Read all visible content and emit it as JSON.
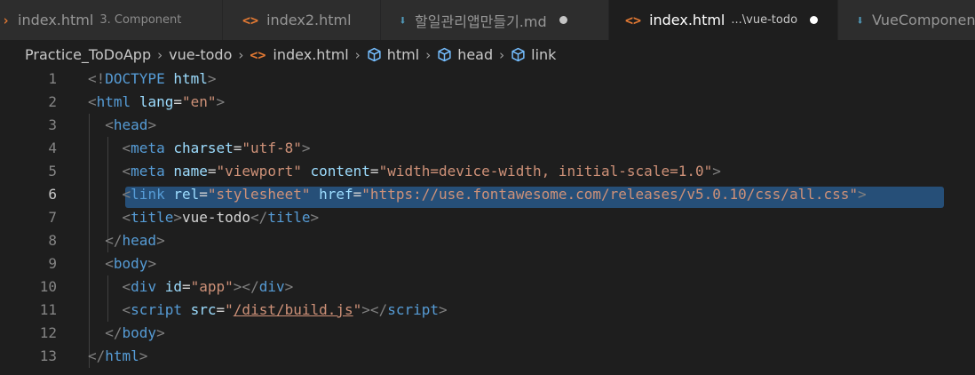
{
  "tabs": [
    {
      "icon": "html-file-icon",
      "label": "index.html",
      "description": "3. Component",
      "active": false,
      "modified": false
    },
    {
      "icon": "html-file-icon",
      "label": "index2.html",
      "description": "",
      "active": false,
      "modified": false
    },
    {
      "icon": "markdown-file-icon",
      "label": "할일관리앱만들기.md",
      "description": "",
      "active": false,
      "modified": true
    },
    {
      "icon": "html-file-icon",
      "label": "index.html",
      "description": "...\\vue-todo",
      "active": true,
      "modified": true
    },
    {
      "icon": "markdown-file-icon",
      "label": "VueComponents.md",
      "description": "",
      "active": false,
      "modified": false
    }
  ],
  "breadcrumb": {
    "folder1": "Practice_ToDoApp",
    "folder2": "vue-todo",
    "file": "index.html",
    "sym1": "html",
    "sym2": "head",
    "sym3": "link"
  },
  "editor": {
    "current_line": 6,
    "lines": [
      {
        "n": "1",
        "tokens": [
          [
            "p",
            "<!"
          ],
          [
            "t",
            "DOCTYPE"
          ],
          [
            "x",
            " "
          ],
          [
            "a",
            "html"
          ],
          [
            "p",
            ">"
          ]
        ]
      },
      {
        "n": "2",
        "tokens": [
          [
            "p",
            "<"
          ],
          [
            "t",
            "html"
          ],
          [
            "x",
            " "
          ],
          [
            "a",
            "lang"
          ],
          [
            "x",
            "="
          ],
          [
            "s",
            "\"en\""
          ],
          [
            "p",
            ">"
          ]
        ]
      },
      {
        "n": "3",
        "tokens": [
          [
            "x",
            "  "
          ],
          [
            "p",
            "<"
          ],
          [
            "t",
            "head"
          ],
          [
            "p",
            ">"
          ]
        ]
      },
      {
        "n": "4",
        "tokens": [
          [
            "x",
            "    "
          ],
          [
            "p",
            "<"
          ],
          [
            "t",
            "meta"
          ],
          [
            "x",
            " "
          ],
          [
            "a",
            "charset"
          ],
          [
            "x",
            "="
          ],
          [
            "s",
            "\"utf-8\""
          ],
          [
            "p",
            ">"
          ]
        ]
      },
      {
        "n": "5",
        "tokens": [
          [
            "x",
            "    "
          ],
          [
            "p",
            "<"
          ],
          [
            "t",
            "meta"
          ],
          [
            "x",
            " "
          ],
          [
            "a",
            "name"
          ],
          [
            "x",
            "="
          ],
          [
            "s",
            "\"viewport\""
          ],
          [
            "x",
            " "
          ],
          [
            "a",
            "content"
          ],
          [
            "x",
            "="
          ],
          [
            "s",
            "\"width=device-width, initial-scale=1.0\""
          ],
          [
            "p",
            ">"
          ]
        ]
      },
      {
        "n": "6",
        "tokens": [
          [
            "x",
            "    "
          ],
          [
            "p",
            "<"
          ],
          [
            "t",
            "link"
          ],
          [
            "x",
            " "
          ],
          [
            "a",
            "rel"
          ],
          [
            "x",
            "="
          ],
          [
            "s",
            "\"stylesheet\""
          ],
          [
            "x",
            " "
          ],
          [
            "a",
            "href"
          ],
          [
            "x",
            "="
          ],
          [
            "s",
            "\"https://use.fontawesome.com/releases/v5.0.10/css/all.css\""
          ],
          [
            "p",
            ">"
          ]
        ]
      },
      {
        "n": "7",
        "tokens": [
          [
            "x",
            "    "
          ],
          [
            "p",
            "<"
          ],
          [
            "t",
            "title"
          ],
          [
            "p",
            ">"
          ],
          [
            "x",
            "vue-todo"
          ],
          [
            "p",
            "</"
          ],
          [
            "t",
            "title"
          ],
          [
            "p",
            ">"
          ]
        ]
      },
      {
        "n": "8",
        "tokens": [
          [
            "x",
            "  "
          ],
          [
            "p",
            "</"
          ],
          [
            "t",
            "head"
          ],
          [
            "p",
            ">"
          ]
        ]
      },
      {
        "n": "9",
        "tokens": [
          [
            "x",
            "  "
          ],
          [
            "p",
            "<"
          ],
          [
            "t",
            "body"
          ],
          [
            "p",
            ">"
          ]
        ]
      },
      {
        "n": "10",
        "tokens": [
          [
            "x",
            "    "
          ],
          [
            "p",
            "<"
          ],
          [
            "t",
            "div"
          ],
          [
            "x",
            " "
          ],
          [
            "a",
            "id"
          ],
          [
            "x",
            "="
          ],
          [
            "s",
            "\"app\""
          ],
          [
            "p",
            "></"
          ],
          [
            "t",
            "div"
          ],
          [
            "p",
            ">"
          ]
        ]
      },
      {
        "n": "11",
        "tokens": [
          [
            "x",
            "    "
          ],
          [
            "p",
            "<"
          ],
          [
            "t",
            "script"
          ],
          [
            "x",
            " "
          ],
          [
            "a",
            "src"
          ],
          [
            "x",
            "="
          ],
          [
            "s",
            "\""
          ],
          [
            "su",
            "/dist/build.js"
          ],
          [
            "s",
            "\""
          ],
          [
            "p",
            "></"
          ],
          [
            "t",
            "script"
          ],
          [
            "p",
            ">"
          ]
        ]
      },
      {
        "n": "12",
        "tokens": [
          [
            "x",
            "  "
          ],
          [
            "p",
            "</"
          ],
          [
            "t",
            "body"
          ],
          [
            "p",
            ">"
          ]
        ]
      },
      {
        "n": "13",
        "tokens": [
          [
            "p",
            "</"
          ],
          [
            "t",
            "html"
          ],
          [
            "p",
            ">"
          ]
        ]
      }
    ]
  }
}
